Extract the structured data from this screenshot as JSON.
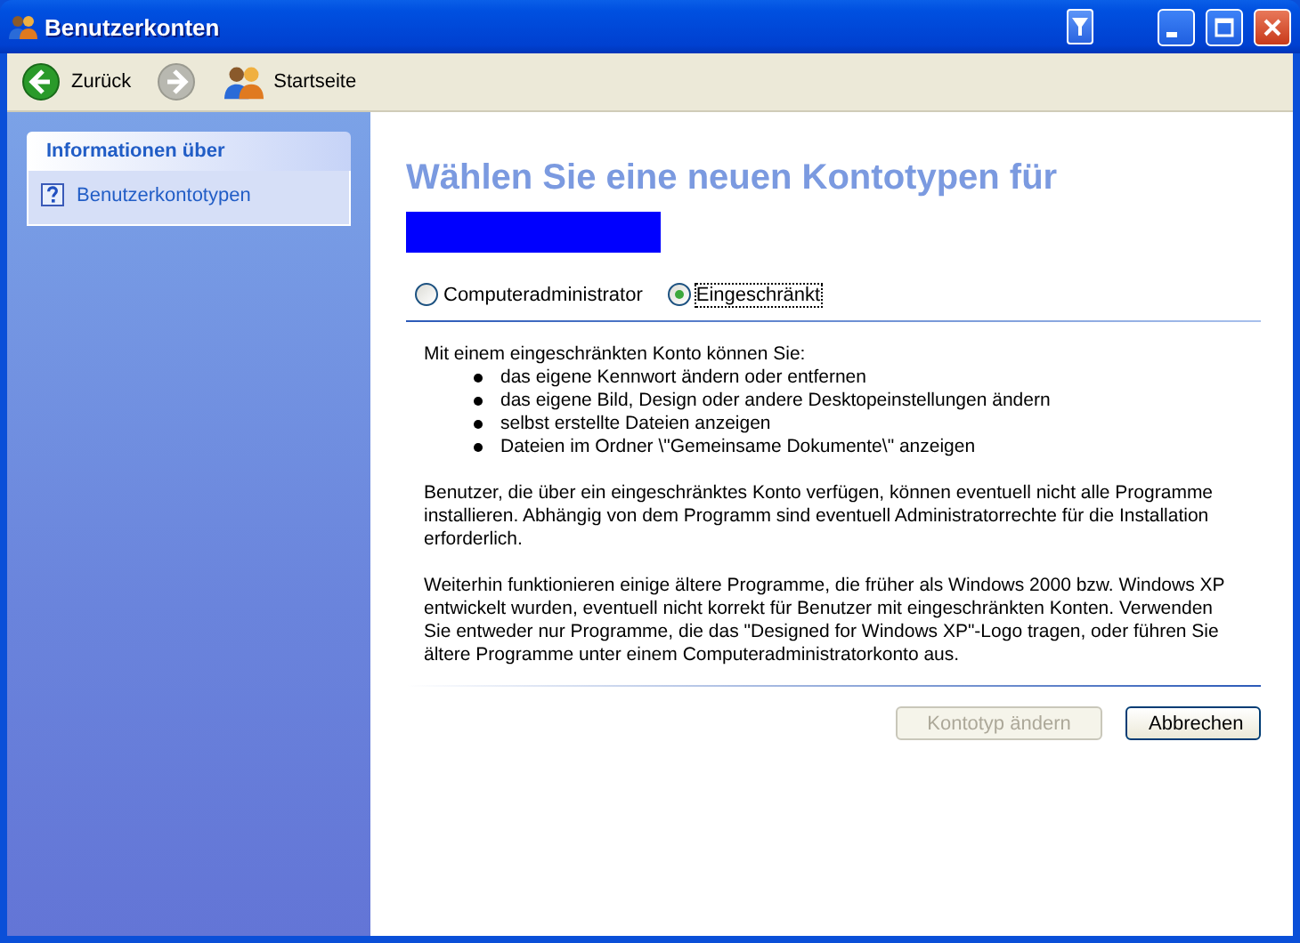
{
  "window": {
    "title": "Benutzerkonten"
  },
  "toolbar": {
    "back": {
      "label": "Zurück",
      "disabled": false
    },
    "forward": {
      "disabled": true
    },
    "home": {
      "label": "Startseite"
    }
  },
  "sidebar": {
    "heading": "Informationen über",
    "items": [
      {
        "label": "Benutzerkontotypen"
      }
    ]
  },
  "content": {
    "heading": "Wählen Sie eine neuen Kontotypen für",
    "options": [
      {
        "label": "Computeradministrator",
        "selected": false
      },
      {
        "label": "Eingeschränkt",
        "selected": true
      }
    ],
    "intro": "Mit einem eingeschränkten Konto können Sie:",
    "bullets": [
      "das eigene Kennwort ändern oder entfernen",
      "das eigene Bild, Design oder andere Desktopeinstellungen ändern",
      "selbst erstellte Dateien anzeigen",
      "Dateien im Ordner \\\"Gemeinsame Dokumente\\\" anzeigen"
    ],
    "paragraphs": [
      "Benutzer, die über ein eingeschränktes Konto verfügen, können eventuell nicht alle Programme installieren. Abhängig von dem Programm sind eventuell Administratorrechte für die Installation erforderlich.",
      "Weiterhin funktionieren einige ältere Programme, die früher als Windows 2000 bzw. Windows XP entwickelt wurden, eventuell nicht korrekt für Benutzer mit eingeschränkten Konten. Verwenden Sie entweder nur Programme, die das \"Designed for Windows XP\"-Logo tragen, oder führen Sie ältere Programme unter einem Computeradministratorkonto aus."
    ]
  },
  "buttons": [
    {
      "label": "Kontotyp ändern",
      "disabled": true
    },
    {
      "label": "Abbrechen",
      "disabled": false
    }
  ]
}
